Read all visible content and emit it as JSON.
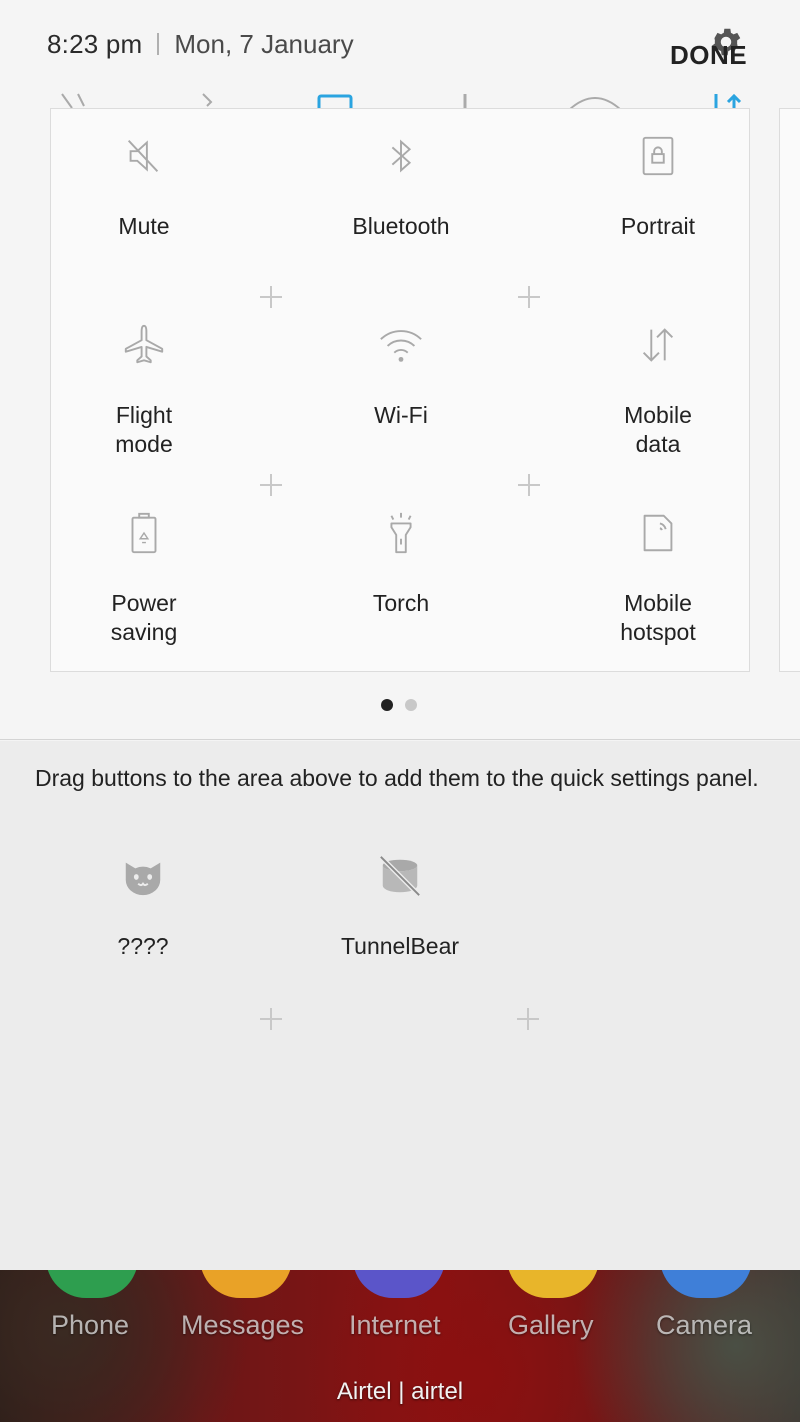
{
  "status_bar": {
    "time": "8:23 pm",
    "date": "Mon, 7 January"
  },
  "header": {
    "done_label": "DONE"
  },
  "active_tiles": [
    {
      "label": "Mute",
      "icon": "mute-icon"
    },
    {
      "label": "Bluetooth",
      "icon": "bluetooth-icon"
    },
    {
      "label": "Portrait",
      "icon": "portrait-lock-icon"
    },
    {
      "label": "Flight\nmode",
      "icon": "airplane-icon"
    },
    {
      "label": "Wi-Fi",
      "icon": "wifi-icon"
    },
    {
      "label": "Mobile\ndata",
      "icon": "mobile-data-icon"
    },
    {
      "label": "Power\nsaving",
      "icon": "power-saving-icon"
    },
    {
      "label": "Torch",
      "icon": "torch-icon"
    },
    {
      "label": "Mobile\nhotspot",
      "icon": "hotspot-icon"
    }
  ],
  "pager": {
    "pages": 2,
    "current": 1
  },
  "available": {
    "hint": "Drag buttons to the area above to add them to the quick settings panel.",
    "tiles": [
      {
        "label": "????",
        "icon": "cat-icon"
      },
      {
        "label": "TunnelBear",
        "icon": "tunnelbear-icon"
      }
    ]
  },
  "dock": {
    "apps": [
      {
        "label": "Phone",
        "color": "#2e9e4f"
      },
      {
        "label": "Messages",
        "color": "#e9a227"
      },
      {
        "label": "Internet",
        "color": "#5b55c9"
      },
      {
        "label": "Gallery",
        "color": "#e8b52a"
      },
      {
        "label": "Camera",
        "color": "#3f7fd8"
      }
    ],
    "carrier": "Airtel | airtel"
  },
  "colors": {
    "icon_gray": "#a9a9a9",
    "accent_blue": "#2aa4e0"
  }
}
